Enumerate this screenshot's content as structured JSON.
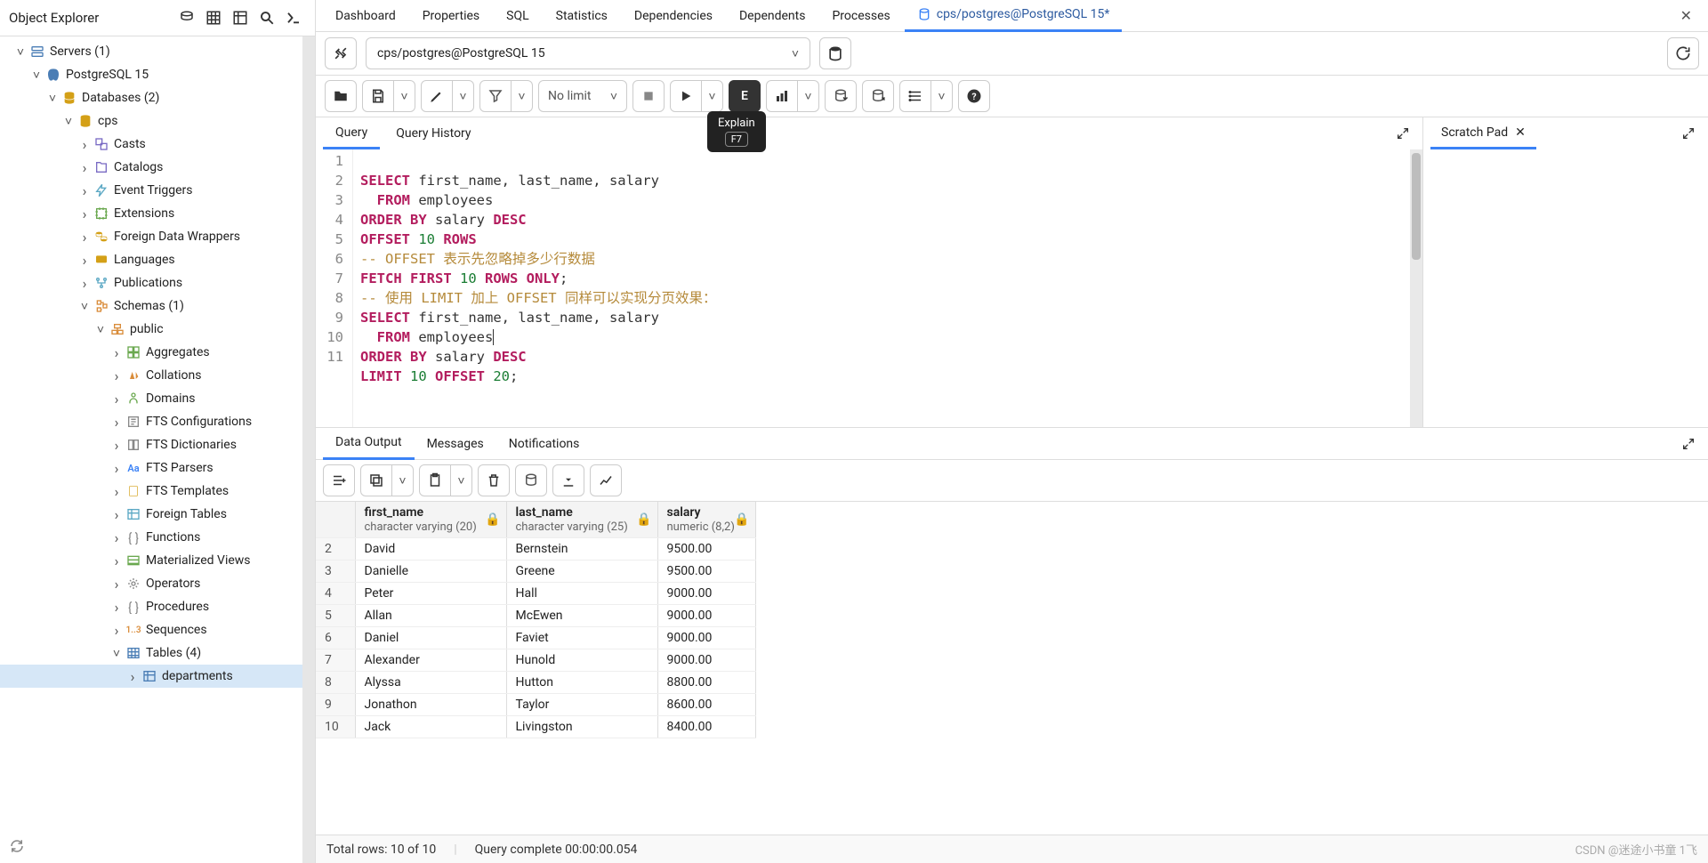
{
  "sidebar": {
    "title": "Object Explorer",
    "servers_label": "Servers (1)",
    "pg_label": "PostgreSQL 15",
    "databases_label": "Databases (2)",
    "db_cps": "cps",
    "nodes": {
      "casts": "Casts",
      "catalogs": "Catalogs",
      "event_triggers": "Event Triggers",
      "extensions": "Extensions",
      "fdw": "Foreign Data Wrappers",
      "languages": "Languages",
      "publications": "Publications",
      "schemas": "Schemas (1)",
      "public": "public",
      "aggregates": "Aggregates",
      "collations": "Collations",
      "domains": "Domains",
      "fts_conf": "FTS Configurations",
      "fts_dict": "FTS Dictionaries",
      "fts_parsers": "FTS Parsers",
      "fts_templates": "FTS Templates",
      "foreign_tables": "Foreign Tables",
      "functions": "Functions",
      "mat_views": "Materialized Views",
      "operators": "Operators",
      "procedures": "Procedures",
      "sequences": "Sequences",
      "tables": "Tables (4)",
      "departments": "departments"
    }
  },
  "topTabs": {
    "dashboard": "Dashboard",
    "properties": "Properties",
    "sql": "SQL",
    "statistics": "Statistics",
    "dependencies": "Dependencies",
    "dependents": "Dependents",
    "processes": "Processes",
    "active": "cps/postgres@PostgreSQL 15*"
  },
  "conn": {
    "label": "cps/postgres@PostgreSQL 15"
  },
  "toolbar": {
    "limit": "No limit",
    "tooltip_title": "Explain",
    "tooltip_key": "F7"
  },
  "editorTabs": {
    "query": "Query",
    "history": "Query History"
  },
  "scratch": {
    "title": "Scratch Pad"
  },
  "code": {
    "lines": [
      "1",
      "2",
      "3",
      "4",
      "5",
      "6",
      "7",
      "8",
      "9",
      "10",
      "11"
    ],
    "l1a": "SELECT",
    "l1b": " first_name, last_name, salary",
    "l2a": "  FROM",
    "l2b": " employees",
    "l3a": "ORDER BY",
    "l3b": " salary ",
    "l3c": "DESC",
    "l4a": "OFFSET ",
    "l4b": "10",
    "l4c": " ROWS",
    "l5a": "-- OFFSET 表示先忽略掉多少行数据",
    "l6a": "FETCH FIRST ",
    "l6b": "10",
    "l6c": " ROWS ONLY",
    "l6d": ";",
    "l7a": "-- 使用 LIMIT 加上 OFFSET 同样可以实现分页效果：",
    "l8a": "SELECT",
    "l8b": " first_name, last_name, salary",
    "l9a": "  FROM",
    "l9b": " employees",
    "l10a": "ORDER BY",
    "l10b": " salary ",
    "l10c": "DESC",
    "l11a": "LIMIT ",
    "l11b": "10",
    "l11c": " OFFSET ",
    "l11d": "20",
    "l11e": ";"
  },
  "outTabs": {
    "data": "Data Output",
    "messages": "Messages",
    "notifications": "Notifications"
  },
  "columns": {
    "c1_name": "first_name",
    "c1_type": "character varying (20)",
    "c2_name": "last_name",
    "c2_type": "character varying (25)",
    "c3_name": "salary",
    "c3_type": "numeric (8,2)"
  },
  "rows": [
    {
      "n": "2",
      "fn": "David",
      "ln": "Bernstein",
      "sal": "9500.00"
    },
    {
      "n": "3",
      "fn": "Danielle",
      "ln": "Greene",
      "sal": "9500.00"
    },
    {
      "n": "4",
      "fn": "Peter",
      "ln": "Hall",
      "sal": "9000.00"
    },
    {
      "n": "5",
      "fn": "Allan",
      "ln": "McEwen",
      "sal": "9000.00"
    },
    {
      "n": "6",
      "fn": "Daniel",
      "ln": "Faviet",
      "sal": "9000.00"
    },
    {
      "n": "7",
      "fn": "Alexander",
      "ln": "Hunold",
      "sal": "9000.00"
    },
    {
      "n": "8",
      "fn": "Alyssa",
      "ln": "Hutton",
      "sal": "8800.00"
    },
    {
      "n": "9",
      "fn": "Jonathon",
      "ln": "Taylor",
      "sal": "8600.00"
    },
    {
      "n": "10",
      "fn": "Jack",
      "ln": "Livingston",
      "sal": "8400.00"
    }
  ],
  "status": {
    "total": "Total rows: 10 of 10",
    "complete": "Query complete 00:00:00.054",
    "watermark": "CSDN @迷途小书童 1飞"
  }
}
